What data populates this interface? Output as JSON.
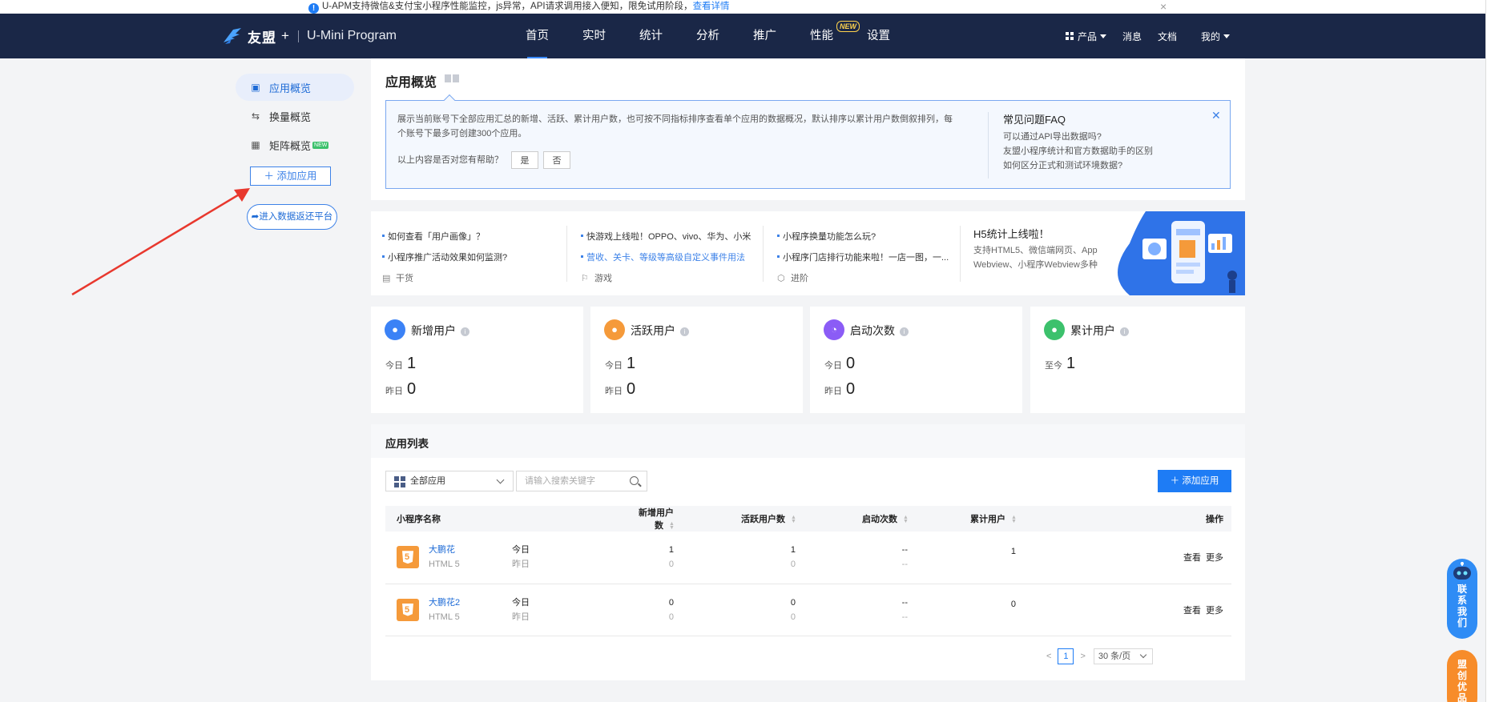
{
  "notice": {
    "text": "U-APM支持微信&支付宝小程序性能监控，js异常，API请求调用接入便知，限免试用阶段，",
    "link": "查看详情"
  },
  "nav": {
    "brand": "友盟",
    "brand_plus": "+",
    "product": "U-Mini Program",
    "items": [
      "首页",
      "实时",
      "统计",
      "分析",
      "推广",
      "性能",
      "设置"
    ],
    "active": "首页",
    "badge": "NEW",
    "right": {
      "products": "产品",
      "messages": "消息",
      "docs": "文档",
      "mine": "我的"
    }
  },
  "sidebar": {
    "items": [
      {
        "label": "应用概览",
        "icon": "monitor-chart-icon"
      },
      {
        "label": "换量概览",
        "icon": "swap-arrows-icon"
      },
      {
        "label": "矩阵概览",
        "icon": "matrix-grid-icon",
        "tag": "NEW"
      }
    ],
    "add_app": "添加应用",
    "enter_platform": "进入数据返还平台"
  },
  "overview": {
    "title": "应用概览",
    "desc": "展示当前账号下全部应用汇总的新增、活跃、累计用户数，也可按不同指标排序查看单个应用的数据概况，默认排序以累计用户数倒叙排列，每个账号下最多可创建300个应用。",
    "help_q": "以上内容是否对您有帮助？",
    "yes": "是",
    "no": "否",
    "faq": {
      "title": "常见问题FAQ",
      "items": [
        "可以通过API导出数据吗?",
        "友盟小程序统计和官方数据助手的区别",
        "如何区分正式和测试环境数据?"
      ]
    }
  },
  "promo": {
    "cols": [
      {
        "items": [
          "如何查看「用户画像」？",
          "小程序推广活动效果如何监测?"
        ],
        "category": "干货"
      },
      {
        "items": [
          "快游戏上线啦！OPPO、vivo、华为、小米",
          "营收、关卡、等级等高级自定义事件用法"
        ],
        "category": "游戏"
      },
      {
        "items": [
          "小程序换量功能怎么玩?",
          "小程序门店排行功能来啦！一店一图，一..."
        ],
        "category": "进阶"
      }
    ],
    "h5_title": "H5统计上线啦！",
    "h5_desc": "支持HTML5、微信端网页、App Webview、小程序Webview多种"
  },
  "stats": [
    {
      "title": "新增用户",
      "color": "#3b82f6",
      "rows": [
        {
          "label": "今日",
          "value": "1"
        },
        {
          "label": "昨日",
          "value": "0"
        }
      ]
    },
    {
      "title": "活跃用户",
      "color": "#f59a3a",
      "rows": [
        {
          "label": "今日",
          "value": "1"
        },
        {
          "label": "昨日",
          "value": "0"
        }
      ]
    },
    {
      "title": "启动次数",
      "color": "#8b5cf6",
      "rows": [
        {
          "label": "今日",
          "value": "0"
        },
        {
          "label": "昨日",
          "value": "0"
        }
      ]
    },
    {
      "title": "累计用户",
      "color": "#3cc16c",
      "rows": [
        {
          "label": "至今",
          "value": "1"
        }
      ]
    }
  ],
  "applist": {
    "title": "应用列表",
    "filter": "全部应用",
    "search_placeholder": "请输入搜索关键字",
    "add": "添加应用",
    "columns": [
      "小程序名称",
      "新增用户数",
      "活跃用户数",
      "启动次数",
      "累计用户",
      "操作"
    ],
    "rows": [
      {
        "name": "大鹏花",
        "platform": "HTML 5",
        "today": "今日",
        "yesterday": "昨日",
        "new": [
          "1",
          "0"
        ],
        "active": [
          "1",
          "0"
        ],
        "launch": [
          "--",
          "--"
        ],
        "total": "1",
        "view": "查看",
        "more": "更多"
      },
      {
        "name": "大鹏花2",
        "platform": "HTML 5",
        "today": "今日",
        "yesterday": "昨日",
        "new": [
          "0",
          "0"
        ],
        "active": [
          "0",
          "0"
        ],
        "launch": [
          "--",
          "--"
        ],
        "total": "0",
        "view": "查看",
        "more": "更多"
      }
    ],
    "pager": {
      "prev": "<",
      "page": "1",
      "next": ">",
      "per_page": "30 条/页"
    }
  },
  "float": {
    "contact": [
      "联",
      "系",
      "我",
      "们"
    ],
    "union": [
      "盟",
      "创",
      "优",
      "品"
    ]
  },
  "colors": {
    "nav_bg": "#1a2747",
    "accent": "#1e7cf5",
    "arrow": "#e8382e"
  }
}
